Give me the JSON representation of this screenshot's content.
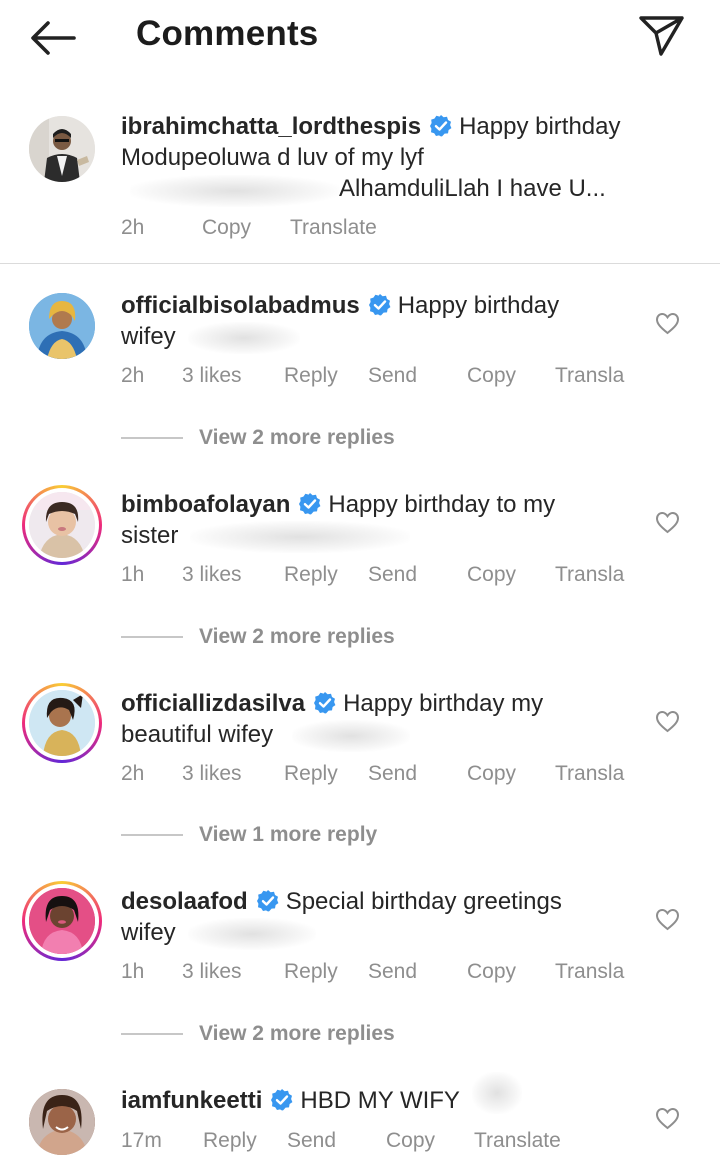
{
  "header": {
    "title": "Comments"
  },
  "caption": {
    "username": "ibrahimchatta_lordthespis",
    "text_line1": "Happy birthday",
    "text_line2": "Modupeoluwa d luv of my lyf",
    "text_line3": "AlhamduliLlah I have U...",
    "time": "2h",
    "copy": "Copy",
    "translate": "Translate"
  },
  "comments": [
    {
      "username": "officialbisolabadmus",
      "text_a": "Happy birthday",
      "text_b": "wifey",
      "time": "2h",
      "likes": "3 likes",
      "reply": "Reply",
      "send": "Send",
      "copy": "Copy",
      "translate": "Transla",
      "more": "View 2 more replies"
    },
    {
      "username": "bimboafolayan",
      "text_a": "Happy birthday to my",
      "text_b": "sister",
      "time": "1h",
      "likes": "3 likes",
      "reply": "Reply",
      "send": "Send",
      "copy": "Copy",
      "translate": "Transla",
      "more": "View 2 more replies"
    },
    {
      "username": "officiallizdasilva",
      "text_a": "Happy birthday my",
      "text_b": "beautiful wifey",
      "time": "2h",
      "likes": "3 likes",
      "reply": "Reply",
      "send": "Send",
      "copy": "Copy",
      "translate": "Transla",
      "more": "View 1 more reply"
    },
    {
      "username": "desolaafod",
      "text_a": "Special birthday greetings",
      "text_b": "wifey",
      "time": "1h",
      "likes": "3 likes",
      "reply": "Reply",
      "send": "Send",
      "copy": "Copy",
      "translate": "Transla",
      "more": "View 2 more replies"
    },
    {
      "username": "iamfunkeetti",
      "text_a": "HBD MY WIFY",
      "time": "17m",
      "reply": "Reply",
      "send": "Send",
      "copy": "Copy",
      "translate": "Translate"
    }
  ],
  "icons": {
    "back": "arrow-left-icon",
    "send": "paper-plane-icon",
    "verified": "verified-badge-icon",
    "like": "heart-outline-icon"
  },
  "colors": {
    "verified": "#3897f0",
    "meta_text": "#8e8e8e",
    "story_ring_start": "#f9ce34",
    "story_ring_mid": "#ee2a7b"
  }
}
